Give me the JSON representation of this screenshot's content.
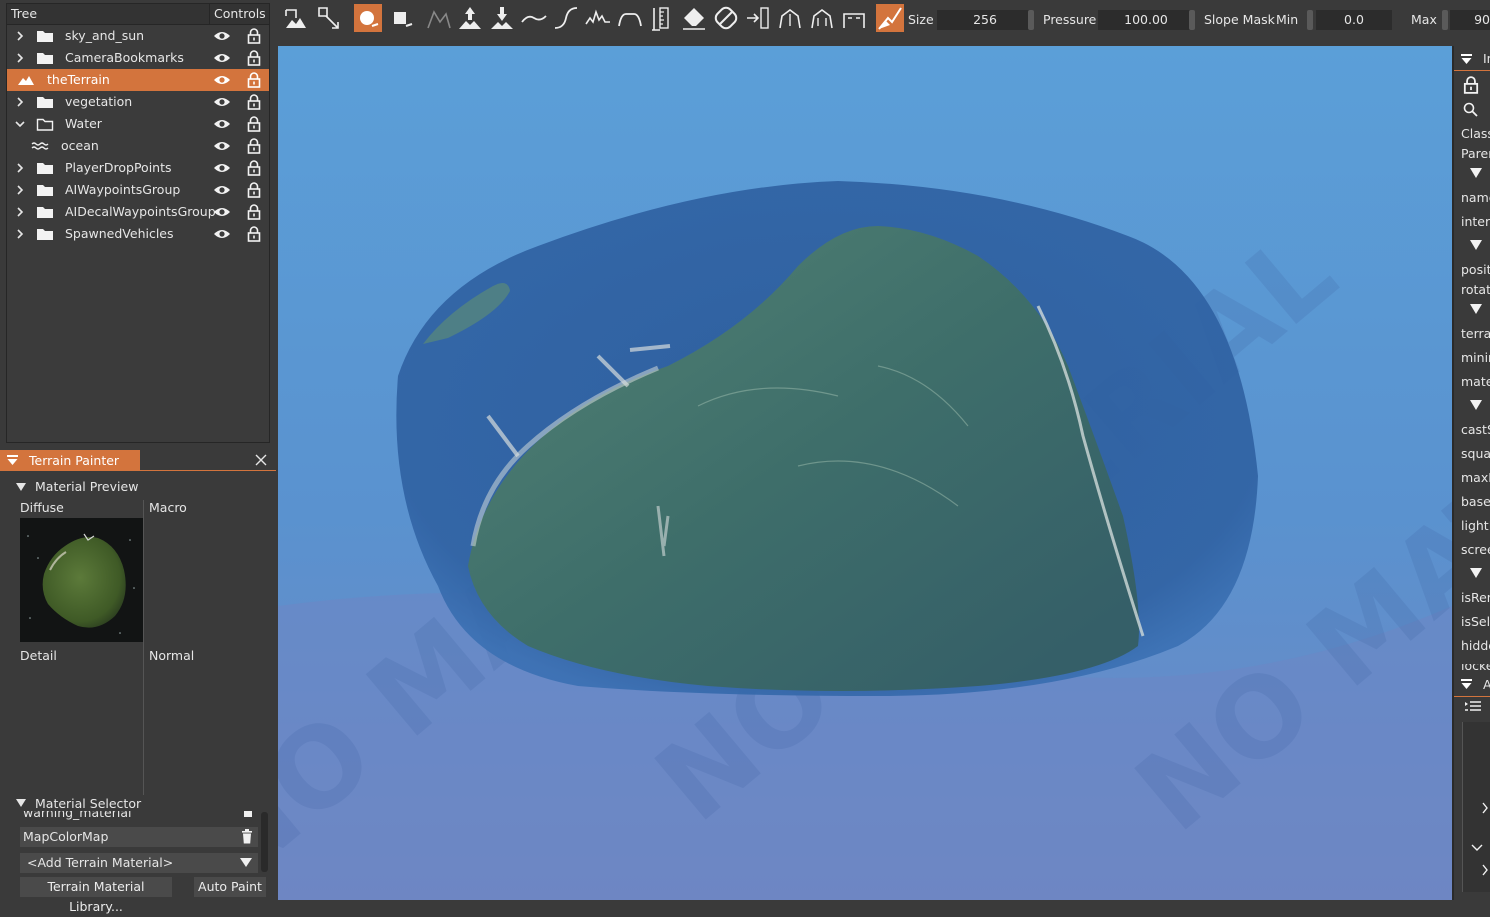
{
  "tree": {
    "header_tree": "Tree",
    "header_controls": "Controls",
    "items": [
      {
        "label": "sky_and_sun",
        "icon": "folder-icon",
        "expander": "collapsed"
      },
      {
        "label": "CameraBookmarks",
        "icon": "folder-icon",
        "expander": "collapsed"
      },
      {
        "label": "theTerrain",
        "icon": "terrain-icon",
        "expander": "none",
        "selected": true
      },
      {
        "label": "vegetation",
        "icon": "folder-icon",
        "expander": "collapsed"
      },
      {
        "label": "Water",
        "icon": "folder-open-icon",
        "expander": "expanded"
      },
      {
        "label": "ocean",
        "icon": "water-icon",
        "expander": "none"
      },
      {
        "label": "PlayerDropPoints",
        "icon": "folder-icon",
        "expander": "collapsed"
      },
      {
        "label": "AIWaypointsGroup",
        "icon": "folder-icon",
        "expander": "collapsed"
      },
      {
        "label": "AIDecalWaypointsGroup",
        "icon": "folder-icon",
        "expander": "collapsed"
      },
      {
        "label": "SpawnedVehicles",
        "icon": "folder-icon",
        "expander": "collapsed"
      }
    ]
  },
  "painter": {
    "title": "Terrain Painter",
    "material_preview": "Material Preview",
    "diffuse": "Diffuse",
    "macro": "Macro",
    "detail": "Detail",
    "normal": "Normal",
    "material_selector": "Material Selector",
    "materials": [
      "warning_material",
      "MapColorMap"
    ],
    "add_material": "<Add Terrain Material>",
    "library_button": "Terrain Material Library...",
    "auto_paint_button": "Auto Paint"
  },
  "toolbar": {
    "size_label": "Size",
    "size_value": "256",
    "pressure_label": "Pressure",
    "pressure_value": "100.00",
    "slope_mask_label": "Slope Mask",
    "min_label": "Min",
    "min_value": "0.0",
    "max_label": "Max",
    "max_value": "90",
    "accent": "#d3743d"
  },
  "viewport": {
    "watermark": "NO MATERIAL"
  },
  "inspector": {
    "tab_label": "In",
    "lower_tab_label": "A",
    "fields": [
      "Class:",
      "Paren",
      "name",
      "intern",
      "positi",
      "rotati",
      "terrai",
      "minim",
      "mater",
      "castS",
      "squar",
      "maxH",
      "baseT",
      "lightM",
      "screen",
      "isRen",
      "isSele",
      "hidde",
      "locke"
    ]
  }
}
